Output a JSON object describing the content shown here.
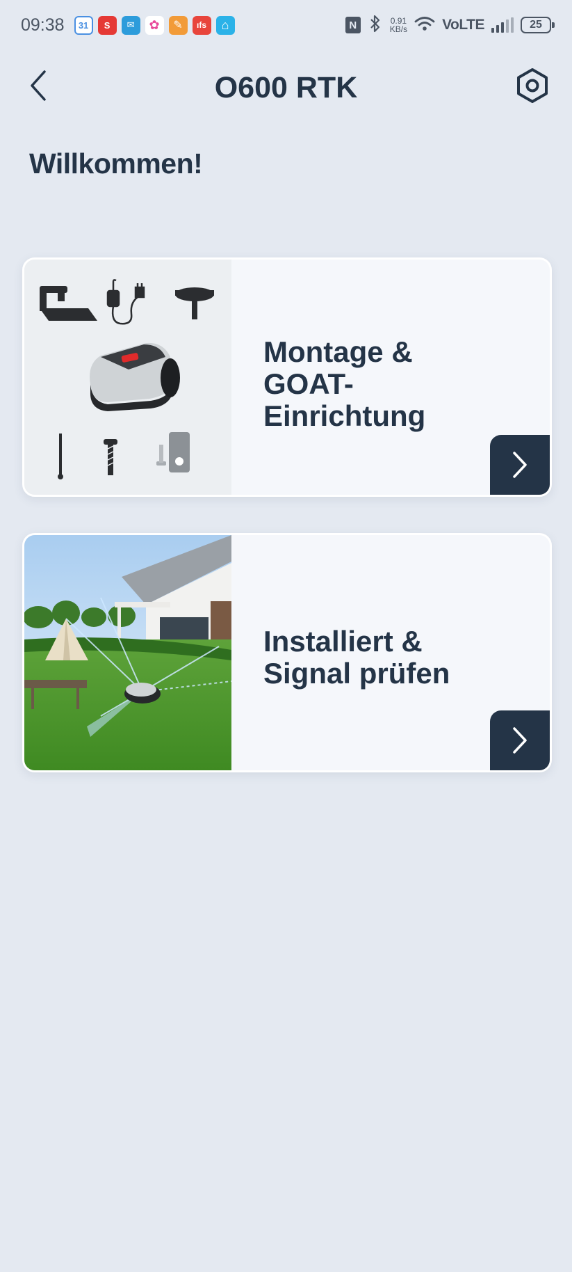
{
  "status_bar": {
    "time": "09:38",
    "notifications": [
      {
        "icon": "calendar-icon",
        "text": "31",
        "color": "#4a90e2"
      },
      {
        "icon": "s-app-icon",
        "text": "S",
        "color": "#e53935"
      },
      {
        "icon": "mail-icon",
        "text": "✉",
        "color": "#2d9cdb"
      },
      {
        "icon": "pinwheel-icon",
        "text": "✿",
        "color": "#ffffff"
      },
      {
        "icon": "note-icon",
        "text": "✎",
        "color": "#f29b38"
      },
      {
        "icon": "red-app-icon",
        "text": "ıfs",
        "color": "#e8453c"
      },
      {
        "icon": "home-app-icon",
        "text": "⌂",
        "color": "#2bb2e8"
      }
    ],
    "nfc": "N",
    "speed_value": "0.91",
    "speed_unit": "KB/s",
    "network": "VoLTE",
    "battery": "25"
  },
  "header": {
    "title": "O600 RTK",
    "back_icon": "chevron-left-icon",
    "settings_icon": "hex-settings-icon"
  },
  "welcome": "Willkommen!",
  "cards": [
    {
      "lines": [
        "Montage &",
        "GOAT-",
        "Einrichtung"
      ],
      "image": "mower-accessories-image",
      "arrow_icon": "chevron-right-icon"
    },
    {
      "lines": [
        "Installiert &",
        "Signal prüfen"
      ],
      "image": "garden-signal-image",
      "arrow_icon": "chevron-right-icon"
    }
  ],
  "colors": {
    "background": "#e4e9f1",
    "card": "#f5f7fb",
    "accent": "#243447"
  }
}
